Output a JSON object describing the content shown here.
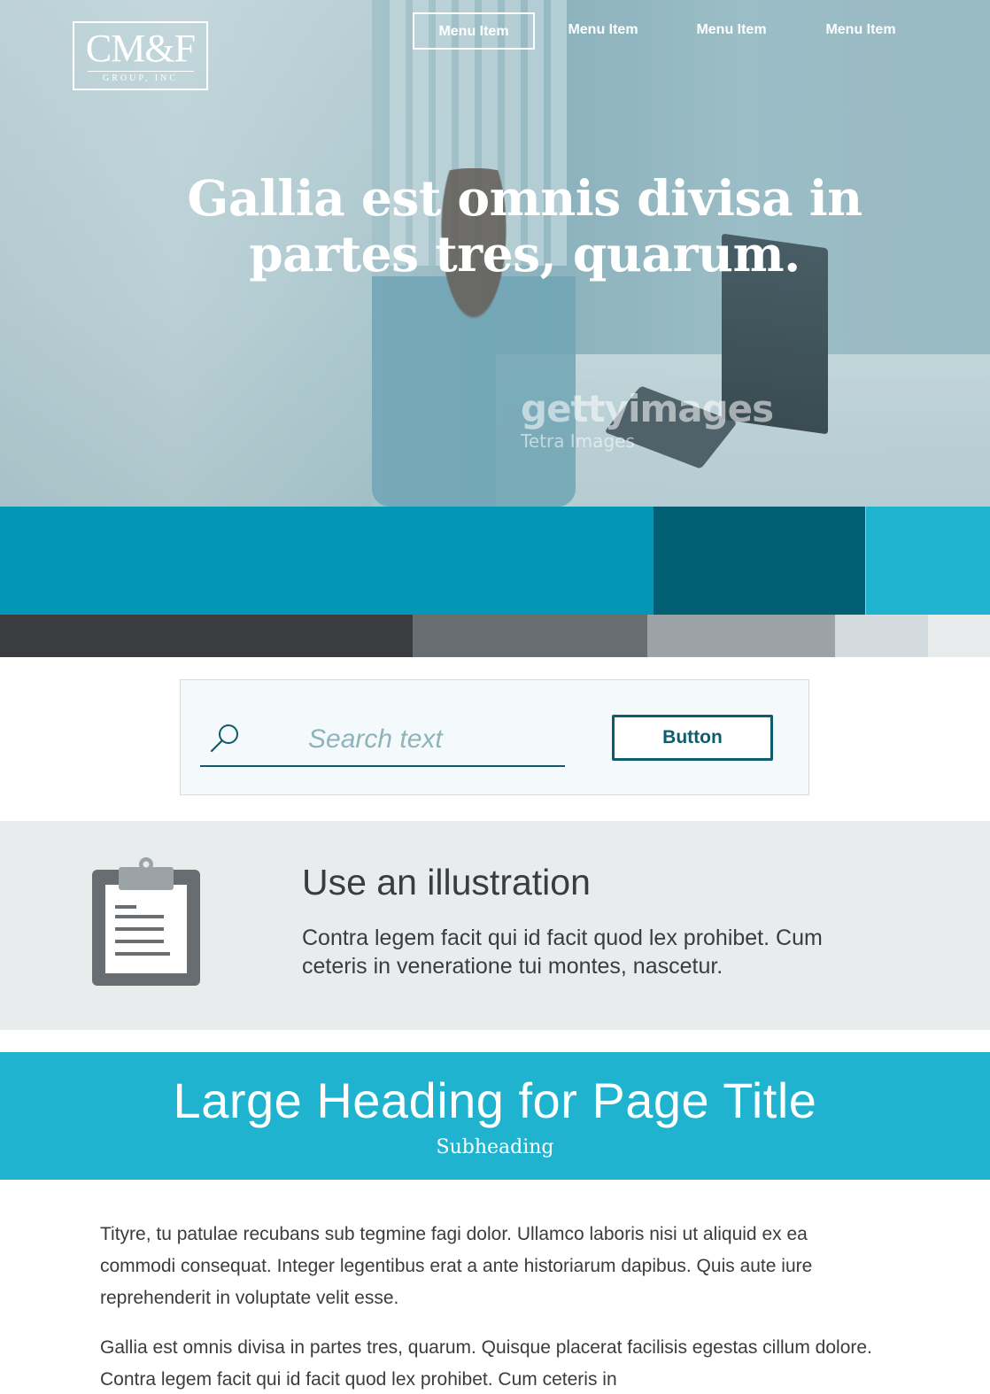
{
  "logo": {
    "mark": "CM&F",
    "sub": "GROUP, INC"
  },
  "nav": {
    "items": [
      "Menu Item",
      "Menu Item",
      "Menu Item",
      "Menu Item"
    ]
  },
  "hero": {
    "title": "Gallia est omnis divisa in partes tres, quarum.",
    "watermark_line1": "gettyimages",
    "watermark_line2": "Tetra Images"
  },
  "palette": {
    "band_colors": [
      "#0197b5",
      "#025f73",
      "#1fb3cf"
    ],
    "strip_colors": [
      "#3a3c3f",
      "#686d71",
      "#9ca3a7",
      "#d3dbde",
      "#e8ebec"
    ]
  },
  "search": {
    "placeholder": "Search text",
    "value": "",
    "button_label": "Button",
    "icon": "search-icon"
  },
  "illustration": {
    "icon": "clipboard-icon",
    "title": "Use an illustration",
    "text": "Contra legem facit qui id facit quod lex prohibet. Cum ceteris in veneratione tui montes, nascetur."
  },
  "page_title": {
    "heading": "Large Heading for Page Title",
    "subheading": "Subheading"
  },
  "body": {
    "paragraphs": [
      "Tityre, tu patulae recubans sub tegmine fagi  dolor. Ullamco laboris nisi ut aliquid ex ea commodi consequat. Integer legentibus erat a ante historiarum dapibus. Quis aute iure reprehenderit in voluptate velit esse.",
      "Gallia est omnis divisa in partes tres, quarum. Quisque placerat facilisis egestas cillum dolore. Contra legem facit qui id facit quod lex prohibet. Cum ceteris in"
    ]
  }
}
